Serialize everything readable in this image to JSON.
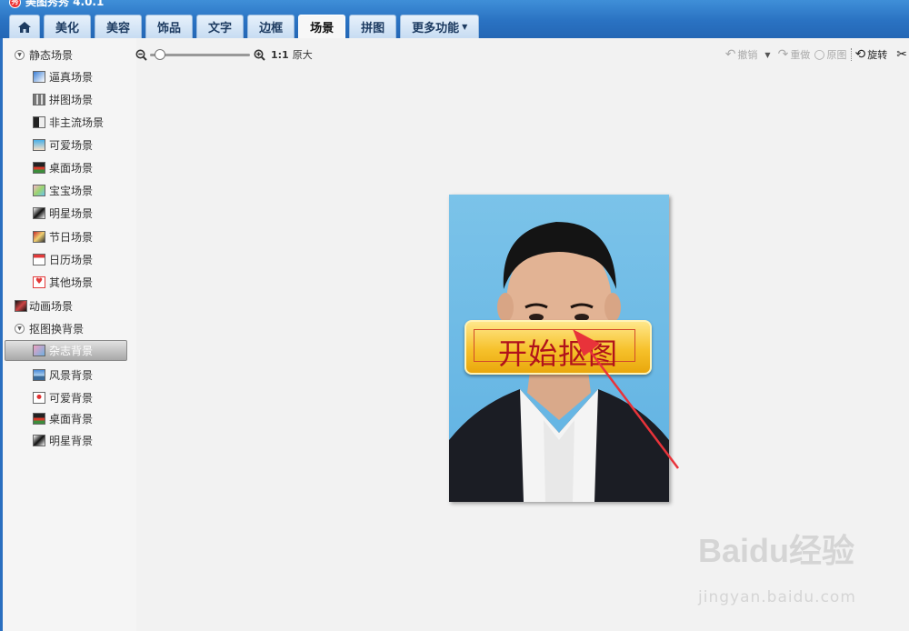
{
  "app": {
    "title": "美图秀秀 4.0.1"
  },
  "tabs": [
    {
      "label": "",
      "icon": "home-icon"
    },
    {
      "label": "美化"
    },
    {
      "label": "美容"
    },
    {
      "label": "饰品"
    },
    {
      "label": "文字"
    },
    {
      "label": "边框"
    },
    {
      "label": "场景",
      "active": true
    },
    {
      "label": "拼图"
    },
    {
      "label": "更多功能"
    }
  ],
  "sidebar": {
    "groups": [
      {
        "label": "静态场景",
        "items": [
          "逼真场景",
          "拼图场景",
          "非主流场景",
          "可爱场景",
          "桌面场景",
          "宝宝场景",
          "明星场景",
          "节日场景",
          "日历场景",
          "其他场景"
        ]
      },
      {
        "label": "动画场景"
      },
      {
        "label": "抠图换背景",
        "items": [
          "杂志背景",
          "风景背景",
          "可爱背景",
          "桌面背景",
          "明星背景"
        ],
        "selected": "杂志背景"
      }
    ]
  },
  "zoom": {
    "ratio_label": "1:1",
    "original_label": "原大",
    "level": 0.05
  },
  "toolbar": {
    "undo": "撤销",
    "redo": "重做",
    "original": "原图",
    "rotate": "旋转"
  },
  "canvas": {
    "cutout_button": "开始抠图"
  },
  "watermark": {
    "brand": "Baidu经验",
    "url": "jingyan.baidu.com"
  },
  "colors": {
    "accent": "#2a72c2",
    "button_yellow": "#f6c12b",
    "button_text": "#b1121b",
    "photo_bg": "#6cb9e6"
  }
}
